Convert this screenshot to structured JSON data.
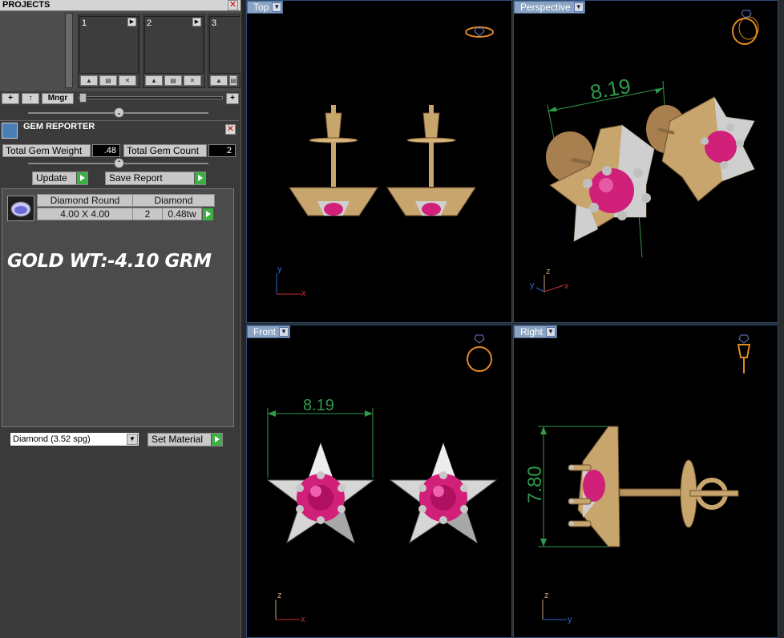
{
  "projects": {
    "title": "PROJECTS",
    "slots": [
      {
        "num": "1"
      },
      {
        "num": "2"
      },
      {
        "num": "3"
      }
    ],
    "tools": {
      "add": "+",
      "up": "↑",
      "manager": "Mngr",
      "add_right": "+"
    }
  },
  "gem_reporter": {
    "title": "GEM REPORTER",
    "total_weight_label": "Total Gem Weight",
    "total_weight_value": ".48",
    "total_count_label": "Total Gem Count",
    "total_count_value": "2",
    "update_label": "Update",
    "save_report_label": "Save Report",
    "row": {
      "shape": "Diamond Round",
      "size": "4.00 X 4.00",
      "material": "Diamond",
      "count": "2",
      "weight": "0.48tw"
    },
    "note": "GOLD WT:-4.10 GRM",
    "material_select": "Diamond    (3.52 spg)",
    "set_material_label": "Set Material"
  },
  "viewports": {
    "top": {
      "label": "Top"
    },
    "perspective": {
      "label": "Perspective",
      "dimension": "8.19"
    },
    "front": {
      "label": "Front",
      "dimension": "8.19"
    },
    "right": {
      "label": "Right",
      "dimension": "7.80"
    }
  },
  "axes": {
    "x": "x",
    "y": "y",
    "z": "z"
  },
  "colors": {
    "gold": "#b89460",
    "ruby": "#d0207a",
    "silver": "#cfcfcf",
    "dimension": "#2f9a4a",
    "tab": "#8aa3c2"
  }
}
